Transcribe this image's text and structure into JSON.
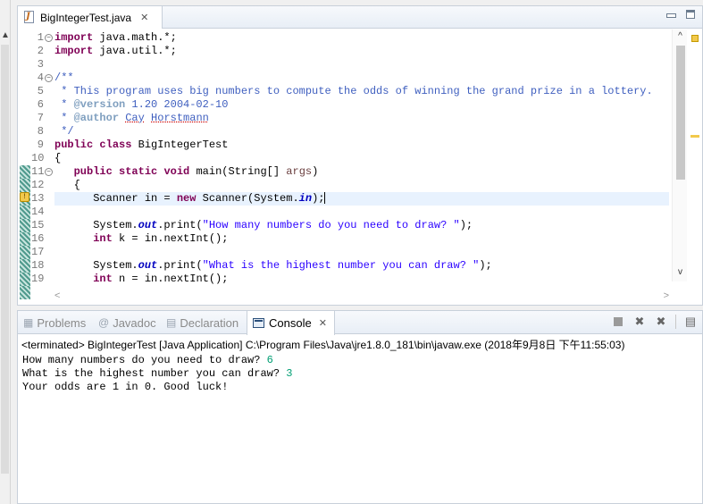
{
  "editor": {
    "tab_label": "BigIntegerTest.java",
    "tab_close": "✕",
    "line_numbers": [
      "1",
      "2",
      "3",
      "4",
      "5",
      "6",
      "7",
      "8",
      "9",
      "10",
      "11",
      "12",
      "13",
      "14",
      "15",
      "16",
      "17",
      "18",
      "19"
    ],
    "code": {
      "l1": {
        "kw": "import",
        "rest": " java.math.*;"
      },
      "l2": {
        "kw": "import",
        "rest": " java.util.*;"
      },
      "l4": "/**",
      "l5": " * This program uses big numbers to compute the odds of winning the grand prize in a lottery.",
      "l6": {
        "prefix": " * ",
        "tag": "@version",
        "rest": " 1.20 2004-02-10"
      },
      "l7": {
        "prefix": " * ",
        "tag": "@author",
        "name1": "Cay",
        "space": " ",
        "name2": "Horstmann"
      },
      "l8": " */",
      "l9": {
        "kw1": "public",
        "kw2": "class",
        "rest": " BigIntegerTest"
      },
      "l10": "{",
      "l11": {
        "indent": "   ",
        "kw1": "public",
        "kw2": "static",
        "kw3": "void",
        "mid": " main(String[] ",
        "param": "args",
        "end": ")"
      },
      "l12": "   {",
      "l13": {
        "pre": "      Scanner in = ",
        "kw": "new",
        "mid": " Scanner(System.",
        "fld": "in",
        "end": ");"
      },
      "l15": {
        "pre": "      System.",
        "fld": "out",
        "mid": ".print(",
        "str": "\"How many numbers do you need to draw? \"",
        "end": ");"
      },
      "l16": {
        "indent": "      ",
        "kw": "int",
        "rest": " k = in.nextInt();"
      },
      "l18": {
        "pre": "      System.",
        "fld": "out",
        "mid": ".print(",
        "str": "\"What is the highest number you can draw? \"",
        "end": ");"
      },
      "l19": {
        "indent": "      ",
        "kw": "int",
        "rest": " n = in.nextInt();"
      }
    },
    "scroll_left": "<",
    "scroll_right": ">",
    "scroll_up": "^",
    "scroll_down": "v"
  },
  "views": {
    "tabs": {
      "problems": "Problems",
      "javadoc": "Javadoc",
      "declaration": "Declaration",
      "console": "Console"
    },
    "icons": {
      "problems": "problems-icon",
      "javadoc": "at-icon",
      "declaration": "declaration-icon",
      "console": "console-icon"
    },
    "console_tab_close": "✕",
    "console_status": "<terminated> BigIntegerTest [Java Application] C:\\Program Files\\Java\\jre1.8.0_181\\bin\\javaw.exe (2018年9月8日 下午11:55:03)",
    "output": [
      {
        "text": "How many numbers do you need to draw? ",
        "input": "6"
      },
      {
        "text": "What is the highest number you can draw? ",
        "input": "3"
      },
      {
        "text": "Your odds are 1 in 0. Good luck!",
        "input": ""
      }
    ]
  },
  "colors": {
    "keyword": "#7f0055",
    "comment": "#3f5fbf",
    "string": "#2a00ff",
    "field": "#0000c0",
    "user_input": "#009e73",
    "current_line": "#e8f2fe"
  }
}
